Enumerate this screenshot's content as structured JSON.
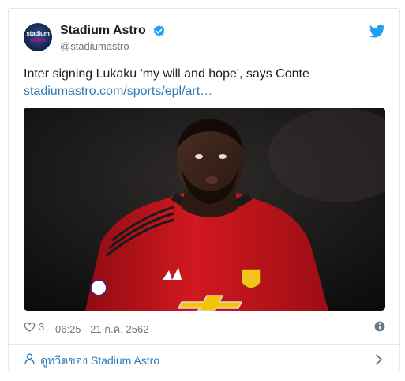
{
  "account": {
    "display_name": "Stadium Astro",
    "handle": "@stadiumastro",
    "avatar_text_top": "stadium",
    "avatar_text_bottom": "astro",
    "verified": true
  },
  "tweet": {
    "text": "Inter signing Lukaku 'my will and hope', says Conte",
    "link": "stadiumastro.com/sports/epl/art…",
    "media_alt": "Footballer in red Manchester United kit"
  },
  "meta": {
    "like_count": "3",
    "timestamp": "06:25 - 21 ก.ค. 2562"
  },
  "footer": {
    "label": "ดูทวีตของ Stadium Astro"
  },
  "icons": {
    "brand": "twitter-bird-icon",
    "verified": "verified-badge-icon",
    "like": "heart-icon",
    "info": "info-icon",
    "profile": "person-icon",
    "next": "chevron-right-icon"
  },
  "colors": {
    "link": "#2b7bb9",
    "twitter_blue": "#1da1f2",
    "muted": "#697882",
    "border": "#e1e8ed",
    "kit_red": "#c4121a"
  }
}
